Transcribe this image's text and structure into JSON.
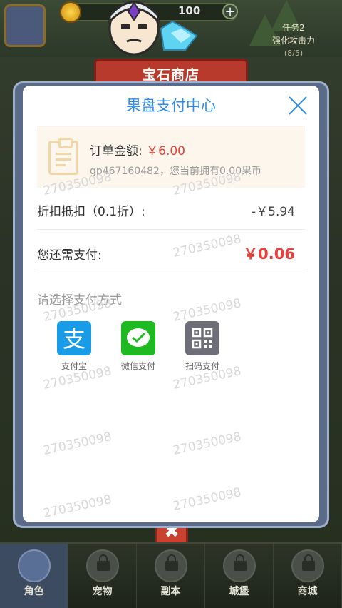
{
  "game": {
    "coin_value": "100",
    "mission": {
      "title": "任务2",
      "desc": "强化攻击力",
      "progress": "(8/5)"
    },
    "shop_banner": "宝石商店",
    "bottom_nav": [
      {
        "label": "角色",
        "active": true
      },
      {
        "label": "宠物",
        "active": false
      },
      {
        "label": "副本",
        "active": false
      },
      {
        "label": "城堡",
        "active": false
      },
      {
        "label": "商城",
        "active": false
      }
    ],
    "close_symbol": "✖"
  },
  "payment": {
    "title": "果盘支付中心",
    "order_label": "订单金额:",
    "order_amount": "￥6.00",
    "account_info": "gp467160482，您当前拥有0.00果币",
    "discount_label": "折扣抵扣（0.1折）:",
    "discount_value": "-￥5.94",
    "remaining_label": "您还需支付:",
    "remaining_value": "￥0.06",
    "method_prompt": "请选择支付方式",
    "methods": [
      {
        "label": "支付宝",
        "icon": "alipay-icon",
        "color": "#1a9be6"
      },
      {
        "label": "微信支付",
        "icon": "wechat-icon",
        "color": "#1fb922"
      },
      {
        "label": "扫码支付",
        "icon": "qrcode-icon",
        "color": "#6e6e78"
      }
    ],
    "watermark": "270350098"
  }
}
